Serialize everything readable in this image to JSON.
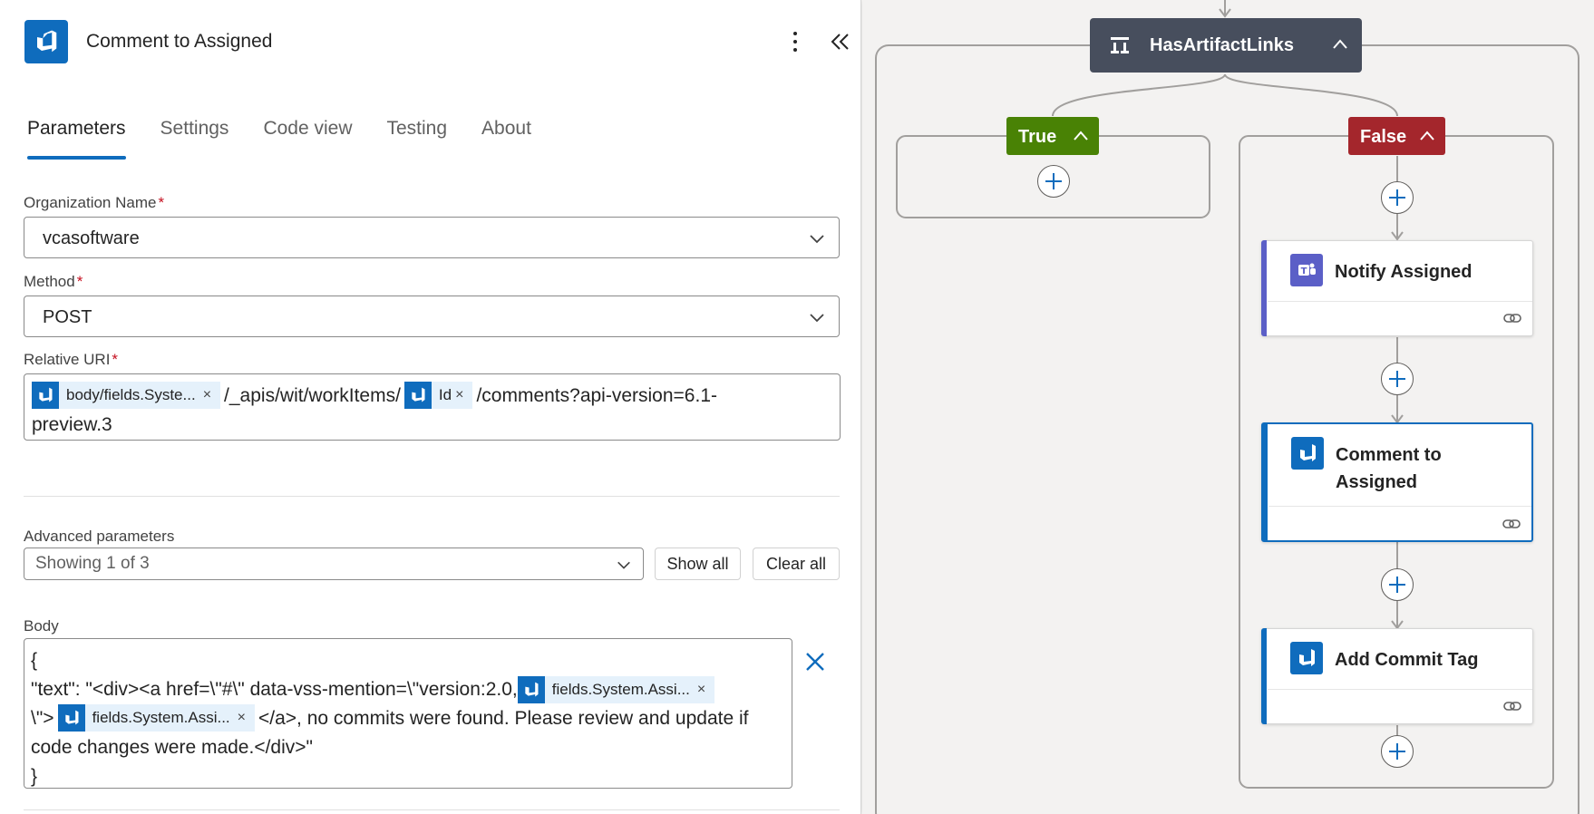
{
  "panel": {
    "title": "Comment to Assigned",
    "tabs": [
      {
        "label": "Parameters",
        "active": true
      },
      {
        "label": "Settings",
        "active": false
      },
      {
        "label": "Code view",
        "active": false
      },
      {
        "label": "Testing",
        "active": false
      },
      {
        "label": "About",
        "active": false
      }
    ],
    "organization": {
      "label": "Organization Name",
      "required": "*",
      "value": "vcasoftware"
    },
    "method": {
      "label": "Method",
      "required": "*",
      "value": "POST"
    },
    "relative_uri": {
      "label": "Relative URI",
      "required": "*",
      "token1": "body/fields.Syste...",
      "text1": "/_apis/wit/workItems/",
      "token2": "Id",
      "text2": "/comments?api-version=6.1-",
      "text3": "preview.3"
    },
    "advanced": {
      "label": "Advanced parameters",
      "value": "Showing 1 of 3",
      "show_all": "Show all",
      "clear_all": "Clear all"
    },
    "body": {
      "label": "Body",
      "line1": "{",
      "line2a": "\"text\": \"<div><a href=\\\"#\\\" data-vss-mention=\\\"version:2.0,",
      "token1": "fields.System.Assi...",
      "line3a": "\\\">",
      "token2": "fields.System.Assi...",
      "line3b": "</a>, no commits were found. Please review and update if",
      "line4": "code changes were made.</div>\"",
      "line5": "}"
    },
    "token_close": "×"
  },
  "canvas": {
    "condition": {
      "title": "HasArtifactLinks"
    },
    "true_branch": {
      "label": "True",
      "color": "#498205"
    },
    "false_branch": {
      "label": "False",
      "color": "#a4262c"
    },
    "actions": [
      {
        "title": "Notify Assigned",
        "connector": "teams",
        "color": "#5b5fc7"
      },
      {
        "title": "Comment to Assigned",
        "connector": "azure-devops",
        "color": "#0f6cbd",
        "selected": true
      },
      {
        "title": "Add Commit Tag",
        "connector": "azure-devops",
        "color": "#0f6cbd"
      }
    ]
  },
  "colors": {
    "accent": "#0f6cbd",
    "condition_header": "#474e5d"
  }
}
